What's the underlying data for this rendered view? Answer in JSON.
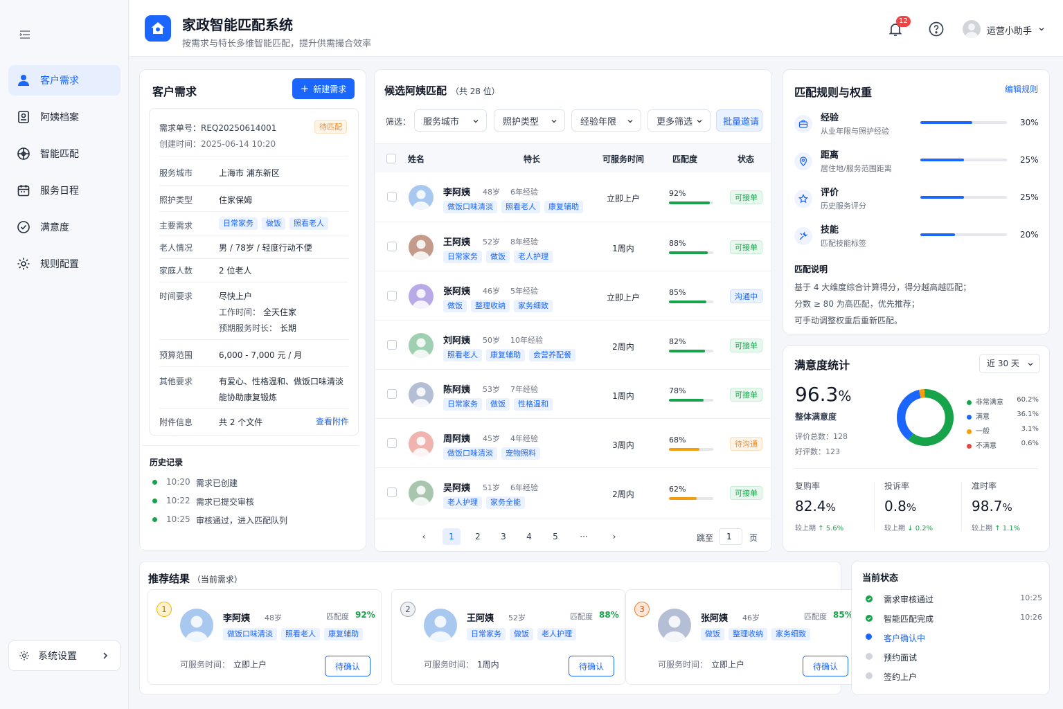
{
  "app": {
    "title": "家政智能匹配系统",
    "subtitle": "按需求与特长多维智能匹配，提升供需撮合效率",
    "notifications": "12",
    "user": "运营小助手"
  },
  "nav": {
    "items": [
      {
        "label": "客户需求",
        "icon": "user-icon"
      },
      {
        "label": "阿姨档案",
        "icon": "profile-icon"
      },
      {
        "label": "智能匹配",
        "icon": "match-icon"
      },
      {
        "label": "服务日程",
        "icon": "calendar-icon"
      },
      {
        "label": "满意度",
        "icon": "check-circle-icon"
      },
      {
        "label": "规则配置",
        "icon": "gear-icon"
      }
    ],
    "settings": "系统设置"
  },
  "demand": {
    "title": "客户需求",
    "new_btn": "新建需求",
    "order_no": "需求单号：REQ20250614001",
    "status": "待匹配",
    "created": "创建时间：2025-06-14 10:20",
    "rows": [
      {
        "label": "服务城市",
        "value": "上海市 浦东新区"
      },
      {
        "label": "照护类型",
        "value": "住家保姆"
      },
      {
        "label": "主要需求",
        "tags": [
          "日常家务",
          "做饭",
          "照看老人"
        ]
      },
      {
        "label": "老人情况",
        "value": "男 / 78岁 / 轻度行动不便"
      },
      {
        "label": "家庭人数",
        "value": "2 位老人"
      },
      {
        "label": "时间要求",
        "value": "尽快上户",
        "line2_k": "工作时间：",
        "line2_v": "全天住家",
        "line3_k": "预期服务时长：",
        "line3_v": "长期"
      },
      {
        "label": "预算范围",
        "value": "6,000 - 7,000 元 / 月"
      },
      {
        "label": "其他要求",
        "value": "有爱心、性格温和、做饭口味清淡",
        "value2": "能协助康复锻炼"
      },
      {
        "label": "附件信息",
        "value": "共 2 个文件",
        "link": "查看附件"
      }
    ],
    "history_title": "历史记录",
    "history": [
      {
        "time": "10:20",
        "event": "需求已创建"
      },
      {
        "time": "10:22",
        "event": "需求已提交审核"
      },
      {
        "time": "10:25",
        "event": "审核通过，进入匹配队列"
      }
    ]
  },
  "candidates": {
    "title": "候选阿姨匹配",
    "count": "（共 28 位）",
    "filter_label": "筛选：",
    "filters": [
      "服务城市",
      "照护类型",
      "经验年限",
      "更多筛选"
    ],
    "batch_btn": "批量邀请",
    "headers": [
      "姓名",
      "特长",
      "可服务时间",
      "匹配度",
      "状态"
    ],
    "rows": [
      {
        "name": "李阿姨",
        "age": "48岁",
        "exp": "6年经验",
        "tags": [
          "做饭口味清淡",
          "照看老人",
          "康复辅助"
        ],
        "time": "立即上户",
        "match": "92%",
        "match_val": 92,
        "bar_color": "#16a34a",
        "status": "可接单",
        "status_type": "green",
        "avatar_bg": "#a9c8ef"
      },
      {
        "name": "王阿姨",
        "age": "52岁",
        "exp": "8年经验",
        "tags": [
          "日常家务",
          "做饭",
          "老人护理"
        ],
        "time": "1周内",
        "match": "88%",
        "match_val": 88,
        "bar_color": "#16a34a",
        "status": "可接单",
        "status_type": "green",
        "avatar_bg": "#c49a8a"
      },
      {
        "name": "张阿姨",
        "age": "46岁",
        "exp": "5年经验",
        "tags": [
          "做饭",
          "整理收纳",
          "家务细致"
        ],
        "time": "立即上户",
        "match": "85%",
        "match_val": 85,
        "bar_color": "#16a34a",
        "status": "沟通中",
        "status_type": "blue",
        "avatar_bg": "#b9a9e6"
      },
      {
        "name": "刘阿姨",
        "age": "50岁",
        "exp": "10年经验",
        "tags": [
          "照看老人",
          "康复辅助",
          "会营养配餐"
        ],
        "time": "2周内",
        "match": "82%",
        "match_val": 82,
        "bar_color": "#16a34a",
        "status": "可接单",
        "status_type": "green",
        "avatar_bg": "#9fd0b2"
      },
      {
        "name": "陈阿姨",
        "age": "53岁",
        "exp": "7年经验",
        "tags": [
          "日常家务",
          "做饭",
          "性格温和"
        ],
        "time": "1周内",
        "match": "78%",
        "match_val": 78,
        "bar_color": "#16a34a",
        "status": "可接单",
        "status_type": "green",
        "avatar_bg": "#b4bfd6"
      },
      {
        "name": "周阿姨",
        "age": "45岁",
        "exp": "4年经验",
        "tags": [
          "做饭口味清淡",
          "宠物照料"
        ],
        "time": "3周内",
        "match": "68%",
        "match_val": 68,
        "bar_color": "#f59e0b",
        "status": "待沟通",
        "status_type": "orange",
        "avatar_bg": "#f1b3ae"
      },
      {
        "name": "吴阿姨",
        "age": "51岁",
        "exp": "6年经验",
        "tags": [
          "老人护理",
          "家务全能"
        ],
        "time": "2周内",
        "match": "62%",
        "match_val": 62,
        "bar_color": "#f59e0b",
        "status": "可接单",
        "status_type": "green",
        "avatar_bg": "#a8c6ad"
      }
    ],
    "pages": [
      "1",
      "2",
      "3",
      "4",
      "5",
      "···"
    ],
    "jump_label": "跳至",
    "jump_value": "1",
    "page_unit": "页"
  },
  "rules": {
    "title": "匹配规则与权重",
    "edit": "编辑规则",
    "items": [
      {
        "name": "经验",
        "desc": "从业年限与照护经验",
        "pct": "30%",
        "val": 30,
        "icon": "briefcase-icon"
      },
      {
        "name": "距离",
        "desc": "居住地/服务范围距离",
        "pct": "25%",
        "val": 25,
        "icon": "location-icon"
      },
      {
        "name": "评价",
        "desc": "历史服务评分",
        "pct": "25%",
        "val": 25,
        "icon": "star-icon"
      },
      {
        "name": "技能",
        "desc": "匹配技能标签",
        "pct": "20%",
        "val": 20,
        "icon": "tools-icon"
      }
    ],
    "note_title": "匹配说明",
    "notes": [
      "基于 4 大维度综合计算得分，得分越高越匹配；",
      "分数 ≥ 80 为高匹配，优先推荐；",
      "可手动调整权重后重新匹配。"
    ]
  },
  "satisfaction": {
    "title": "满意度统计",
    "range": "近 30 天",
    "overall": "96.3",
    "overall_unit": "%",
    "overall_label": "整体满意度",
    "total": "评价总数：128",
    "good": "好评数：123",
    "legend": [
      {
        "label": "非常满意",
        "value": "60.2%",
        "color": "#16a34a"
      },
      {
        "label": "满意",
        "value": "36.1%",
        "color": "#1a66ff"
      },
      {
        "label": "一般",
        "value": "3.1%",
        "color": "#f59e0b"
      },
      {
        "label": "不满意",
        "value": "0.6%",
        "color": "#ef4444"
      }
    ],
    "kpis": [
      {
        "label": "复购率",
        "value": "82.4",
        "unit": "%",
        "prefix": "较上期",
        "delta": "↑ 5.6%"
      },
      {
        "label": "投诉率",
        "value": "0.8",
        "unit": "%",
        "prefix": "较上期",
        "delta": "↓ 0.2%"
      },
      {
        "label": "准时率",
        "value": "98.7",
        "unit": "%",
        "prefix": "较上期",
        "delta": "↑ 1.1%"
      }
    ]
  },
  "recommend": {
    "title": "推荐结果",
    "sub": "（当前需求）",
    "items": [
      {
        "rank": "1",
        "name": "李阿姨",
        "age": "48岁",
        "match_label": "匹配度",
        "match": "92%",
        "tags": [
          "做饭口味清淡",
          "照看老人",
          "康复辅助"
        ],
        "time_label": "可服务时间：",
        "time": "立即上户",
        "btn": "待确认"
      },
      {
        "rank": "2",
        "name": "王阿姨",
        "age": "52岁",
        "match_label": "匹配度",
        "match": "88%",
        "tags": [
          "日常家务",
          "做饭",
          "老人护理"
        ],
        "time_label": "可服务时间：",
        "time": "1周内",
        "btn": "待确认"
      },
      {
        "rank": "3",
        "name": "张阿姨",
        "age": "46岁",
        "match_label": "匹配度",
        "match": "85%",
        "tags": [
          "做饭",
          "整理收纳",
          "家务细致"
        ],
        "time_label": "可服务时间：",
        "time": "立即上户",
        "btn": "待确认"
      }
    ]
  },
  "status": {
    "title": "当前状态",
    "items": [
      {
        "label": "需求审核通过",
        "time": "10:25",
        "state": "done"
      },
      {
        "label": "智能匹配完成",
        "time": "10:26",
        "state": "done"
      },
      {
        "label": "客户确认中",
        "time": "",
        "state": "current"
      },
      {
        "label": "预约面试",
        "time": "",
        "state": "pending"
      },
      {
        "label": "签约上户",
        "time": "",
        "state": "pending"
      }
    ]
  }
}
